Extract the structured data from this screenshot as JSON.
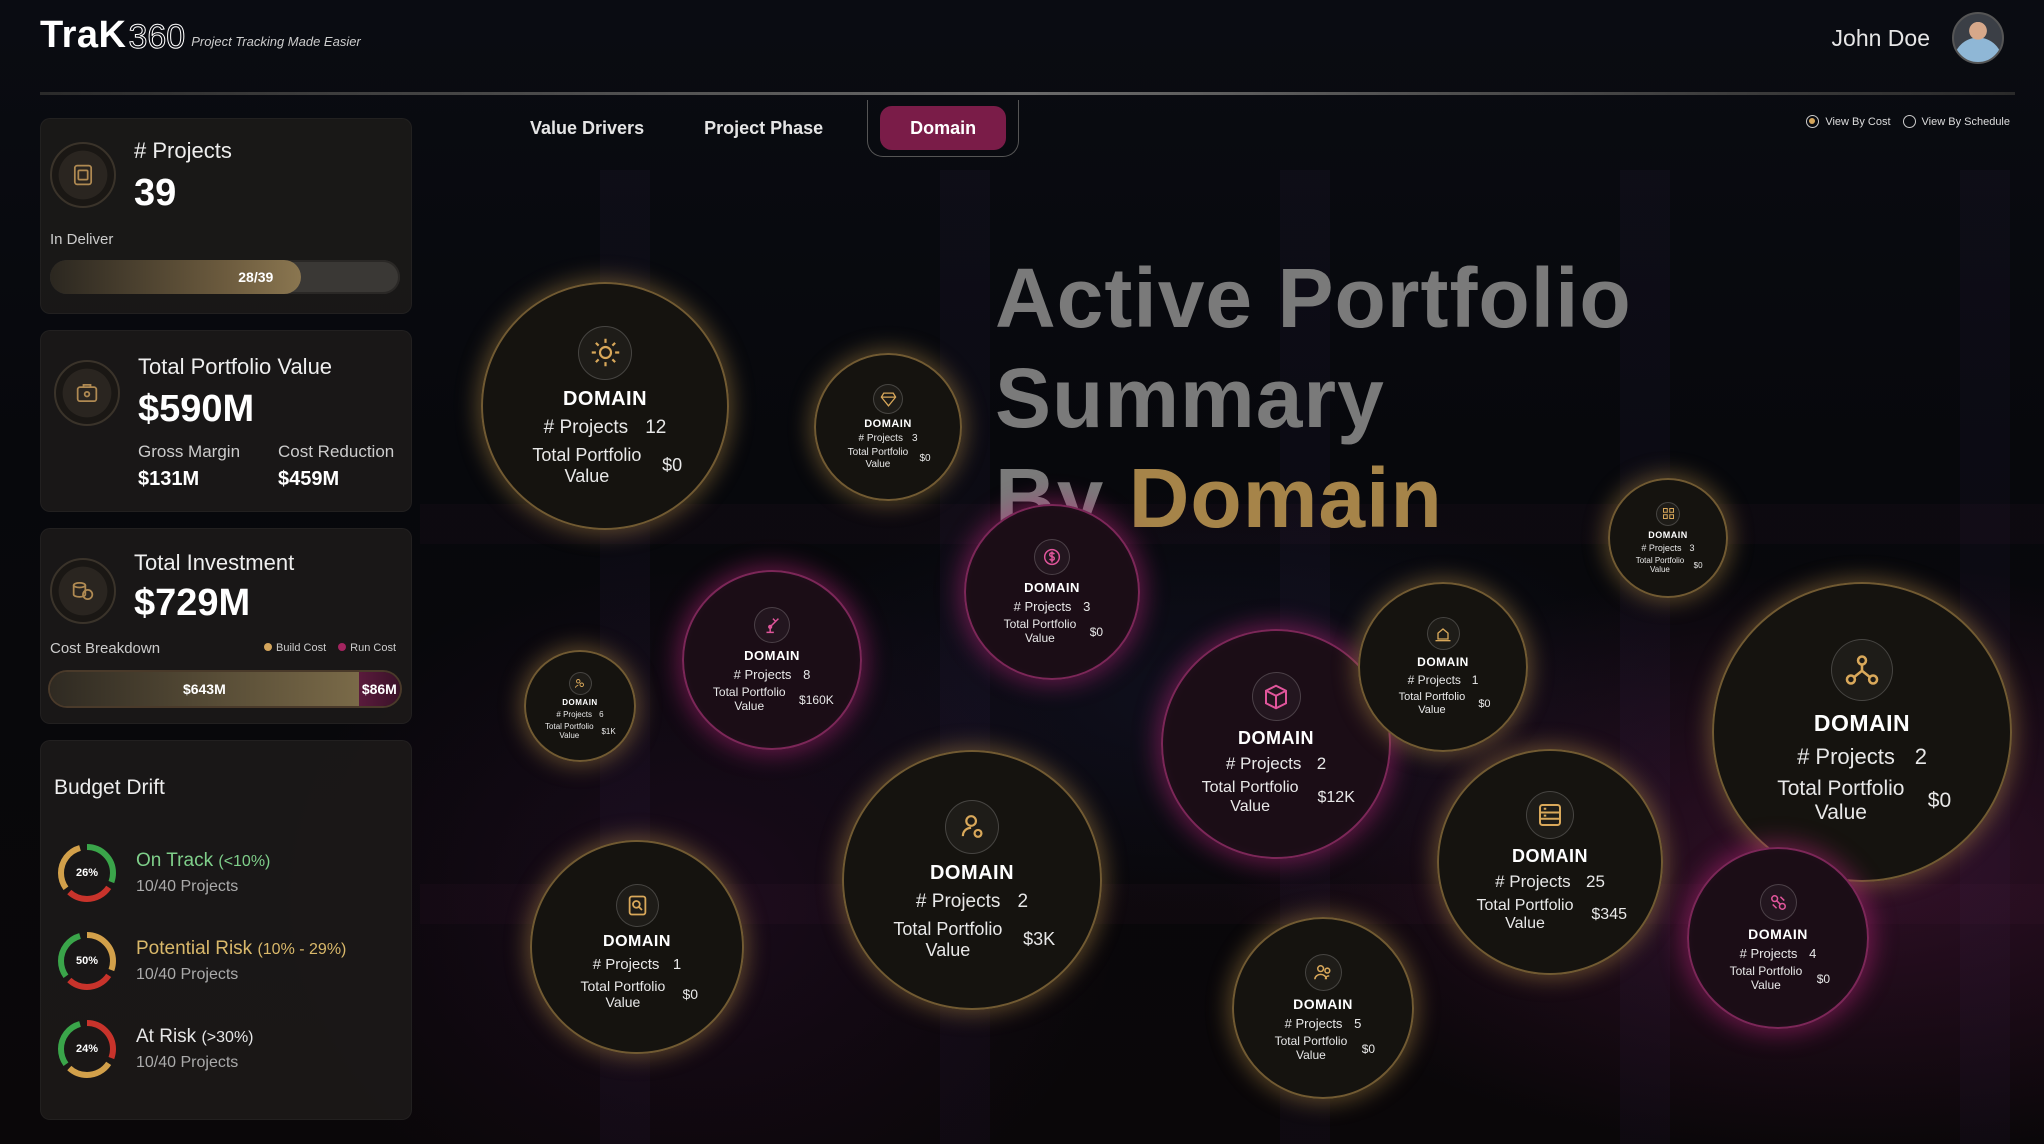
{
  "brand": {
    "name": "TraK",
    "suffix": "360",
    "tagline": "Project Tracking Made Easier"
  },
  "user": {
    "name": "John Doe"
  },
  "tabs": [
    {
      "label": "Value Drivers",
      "active": false
    },
    {
      "label": "Project Phase",
      "active": false
    },
    {
      "label": "Domain",
      "active": true
    }
  ],
  "view_options": [
    {
      "label": "View By Cost",
      "selected": true
    },
    {
      "label": "View By Schedule",
      "selected": false
    }
  ],
  "projects_card": {
    "label": "# Projects",
    "value": "39",
    "sub": "In Deliver",
    "progress_label": "28/39",
    "progress_fraction": 0.718
  },
  "portfolio_card": {
    "label": "Total Portfolio Value",
    "value": "$590M",
    "gm_label": "Gross Margin",
    "gm_value": "$131M",
    "cr_label": "Cost Reduction",
    "cr_value": "$459M"
  },
  "investment_card": {
    "label": "Total Investment",
    "value": "$729M",
    "sub": "Cost Breakdown",
    "legend_build": "Build Cost",
    "legend_run": "Run Cost",
    "build_value": "$643M",
    "run_value": "$86M",
    "build_fraction": 0.882
  },
  "budget_drift": {
    "title": "Budget Drift",
    "rows": [
      {
        "pct": "26%",
        "title": "On Track",
        "range": "(<10%)",
        "sub": "10/40 Projects",
        "color": "#7fcf8a"
      },
      {
        "pct": "50%",
        "title": "Potential Risk",
        "range": "(10% - 29%)",
        "sub": "10/40 Projects",
        "color": "#d9b86a"
      },
      {
        "pct": "24%",
        "title": "At Risk",
        "range": "(>30%)",
        "sub": "10/40 Projects",
        "color": "#e6e6e6"
      }
    ]
  },
  "headline": {
    "line1": "Active Portfolio Summary",
    "line2_a": "By",
    "line2_b": "Domain"
  },
  "bubble_labels": {
    "title": "DOMAIN",
    "projects": "# Projects",
    "value": "Total Portfolio Value"
  },
  "bubbles": [
    {
      "icon": "gear-icon",
      "projects": "12",
      "value": "$0",
      "tone": "gold"
    },
    {
      "icon": "diamond-icon",
      "projects": "3",
      "value": "$0",
      "tone": "gold"
    },
    {
      "icon": "dollar-coin-icon",
      "projects": "3",
      "value": "$0",
      "tone": "pink"
    },
    {
      "icon": "grid-icon",
      "projects": "3",
      "value": "$0",
      "tone": "gold"
    },
    {
      "icon": "robot-arm-icon",
      "projects": "8",
      "value": "$160K",
      "tone": "pink"
    },
    {
      "icon": "gear-people-icon",
      "projects": "6",
      "value": "$1K",
      "tone": "gold"
    },
    {
      "icon": "boxes-icon",
      "projects": "2",
      "value": "$12K",
      "tone": "pink"
    },
    {
      "icon": "hand-house-icon",
      "projects": "1",
      "value": "$0",
      "tone": "gold"
    },
    {
      "icon": "network-icon",
      "projects": "2",
      "value": "$0",
      "tone": "gold"
    },
    {
      "icon": "server-icon",
      "projects": "25",
      "value": "$345",
      "tone": "gold"
    },
    {
      "icon": "person-gear-icon",
      "projects": "2",
      "value": "$3K",
      "tone": "gold"
    },
    {
      "icon": "document-icon",
      "projects": "1",
      "value": "$0",
      "tone": "gold"
    },
    {
      "icon": "team-icon",
      "projects": "5",
      "value": "$0",
      "tone": "gold"
    },
    {
      "icon": "link-icon",
      "projects": "4",
      "value": "$0",
      "tone": "pink"
    }
  ],
  "colors": {
    "accent_gold": "#a68449",
    "accent_pink": "#7a1c48"
  }
}
